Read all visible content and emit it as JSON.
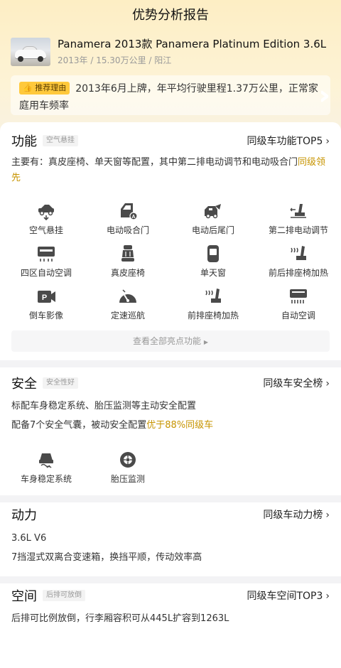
{
  "header": {
    "title": "优势分析报告"
  },
  "car": {
    "name": "Panamera 2013款 Panamera Platinum Edition 3.6L",
    "meta": "2013年 / 15.30万公里 / 阳江"
  },
  "reason": {
    "tag": "推荐理由",
    "text": "2013年6月上牌，年平均行驶里程1.37万公里，正常家庭用车频率"
  },
  "function": {
    "title": "功能",
    "tag": "空气悬挂",
    "link": "同级车功能TOP5",
    "desc_prefix": "主要有：真皮座椅、单天窗等配置，其中第二排电动调节和电动吸合门",
    "desc_highlight": "同级领先",
    "items": [
      {
        "label": "空气悬挂",
        "icon": "air-suspension-icon"
      },
      {
        "label": "电动吸合门",
        "icon": "soft-close-door-icon"
      },
      {
        "label": "电动后尾门",
        "icon": "power-tailgate-icon"
      },
      {
        "label": "第二排电动调节",
        "icon": "second-row-adjust-icon"
      },
      {
        "label": "四区自动空调",
        "icon": "four-zone-ac-icon"
      },
      {
        "label": "真皮座椅",
        "icon": "leather-seat-icon"
      },
      {
        "label": "单天窗",
        "icon": "sunroof-icon"
      },
      {
        "label": "前后排座椅加热",
        "icon": "seat-heating-icon"
      },
      {
        "label": "倒车影像",
        "icon": "rear-camera-icon"
      },
      {
        "label": "定速巡航",
        "icon": "cruise-control-icon"
      },
      {
        "label": "前排座椅加热",
        "icon": "front-seat-heating-icon"
      },
      {
        "label": "自动空调",
        "icon": "auto-ac-icon"
      }
    ],
    "all_button": "查看全部亮点功能"
  },
  "safety": {
    "title": "安全",
    "tag": "安全性好",
    "link": "同级车安全榜",
    "line1": "标配车身稳定系统、胎压监测等主动安全配置",
    "line2_prefix": "配备7个安全气囊，被动安全配置",
    "line2_highlight": "优于88%同级车",
    "items": [
      {
        "label": "车身稳定系统",
        "icon": "stability-control-icon"
      },
      {
        "label": "胎压监测",
        "icon": "tire-pressure-icon"
      }
    ]
  },
  "power": {
    "title": "动力",
    "link": "同级车动力榜",
    "line1": "3.6L V6",
    "line2": "7挡湿式双离合变速箱，换挡平顺，传动效率高"
  },
  "space": {
    "title": "空间",
    "tag": "后排可放倒",
    "link": "同级车空间TOP3",
    "line1": "后排可比例放倒，行李厢容积可从445L扩容到1263L"
  },
  "colors": {
    "accent": "#c79400",
    "tag_yellow": "#ffc93c",
    "icon": "#4a4a4a"
  }
}
